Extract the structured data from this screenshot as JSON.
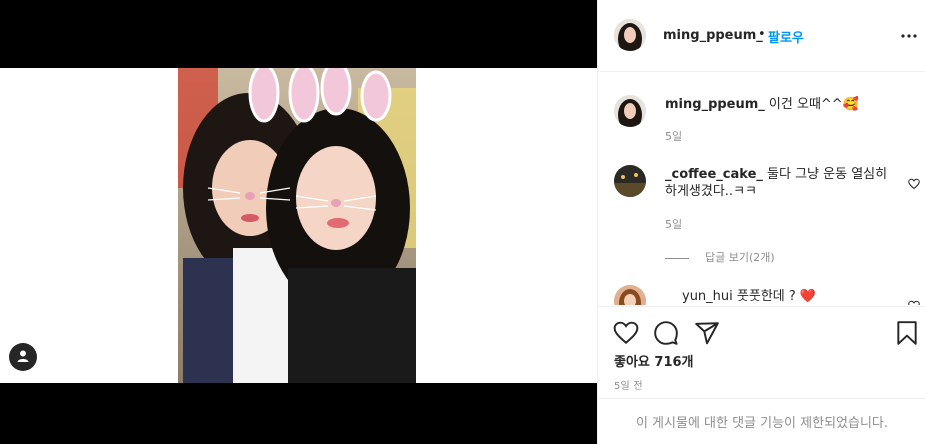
{
  "post": {
    "author": "ming_ppeum_",
    "dot": "•",
    "follow_label": "팔로우"
  },
  "comments": [
    {
      "username": "ming_ppeum_",
      "text": " 이건 오때^^",
      "emoji": "🥰",
      "time": "5일"
    },
    {
      "username": "_coffee_cake_",
      "text": " 둘다 그냥 운동 열심히 하게생겼다..ㅋㅋ",
      "time": "5일",
      "replies_label": "답글 보기(2개)"
    },
    {
      "username": "yun_hui",
      "text": " 풋풋한데 ? ",
      "emoji": "❤️"
    }
  ],
  "likes_label": "좋아요 716개",
  "posted_time": "5일 전",
  "comments_disabled": "이 게시물에 대한 댓글 기능이 제한되었습니다.",
  "icons": {
    "tag": "user-tag-icon",
    "more": "more-options-icon",
    "like": "heart-icon",
    "comment": "comment-icon",
    "share": "send-icon",
    "save": "bookmark-icon"
  },
  "colors": {
    "link": "#0095f6",
    "muted": "#8e8e8e",
    "text": "#262626",
    "heart": "#ed4956"
  }
}
